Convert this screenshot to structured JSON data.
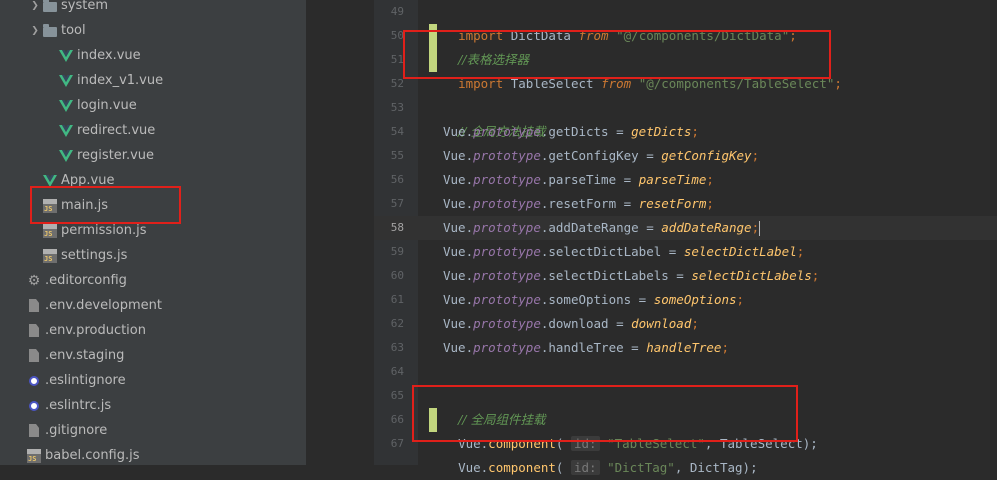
{
  "tree": [
    {
      "id": "system",
      "label": "system",
      "type": "folder",
      "expandable": true
    },
    {
      "id": "tool",
      "label": "tool",
      "type": "folder",
      "expandable": true
    },
    {
      "id": "index-vue",
      "label": "index.vue",
      "type": "vue"
    },
    {
      "id": "index-v1-vue",
      "label": "index_v1.vue",
      "type": "vue"
    },
    {
      "id": "login-vue",
      "label": "login.vue",
      "type": "vue"
    },
    {
      "id": "redirect-vue",
      "label": "redirect.vue",
      "type": "vue"
    },
    {
      "id": "register-vue",
      "label": "register.vue",
      "type": "vue"
    },
    {
      "id": "app-vue",
      "label": "App.vue",
      "type": "vue"
    },
    {
      "id": "main-js",
      "label": "main.js",
      "type": "js"
    },
    {
      "id": "permission-js",
      "label": "permission.js",
      "type": "js"
    },
    {
      "id": "settings-js",
      "label": "settings.js",
      "type": "js"
    },
    {
      "id": "editorconfig",
      "label": ".editorconfig",
      "type": "gear"
    },
    {
      "id": "env-development",
      "label": ".env.development",
      "type": "doc"
    },
    {
      "id": "env-production",
      "label": ".env.production",
      "type": "doc"
    },
    {
      "id": "env-staging",
      "label": ".env.staging",
      "type": "doc"
    },
    {
      "id": "eslintignore",
      "label": ".eslintignore",
      "type": "circle"
    },
    {
      "id": "eslintrc-js",
      "label": ".eslintrc.js",
      "type": "circle"
    },
    {
      "id": "gitignore",
      "label": ".gitignore",
      "type": "doc"
    },
    {
      "id": "babel-config-js",
      "label": "babel.config.js",
      "type": "js"
    }
  ],
  "editor": {
    "line_numbers": [
      "49",
      "50",
      "51",
      "52",
      "53",
      "54",
      "55",
      "56",
      "57",
      "58",
      "59",
      "60",
      "61",
      "62",
      "63",
      "64",
      "65",
      "66",
      "67"
    ],
    "current_line": "58",
    "l49": {
      "kw": "import",
      "name": " DictData ",
      "from": "from",
      "str": "\"@/components/DictData\"",
      "end": ";"
    },
    "l50": {
      "comment": "//表格选择器"
    },
    "l51": {
      "kw": "import",
      "name": " TableSelect ",
      "from": "from",
      "str": "\"@/components/TableSelect\"",
      "end": ";"
    },
    "l53": {
      "comment": "// 全局方法挂载"
    },
    "proto_lines": [
      {
        "obj": "Vue",
        "proto": "prototype",
        "prop": ".getDicts = ",
        "fn": "getDicts",
        "end": ";"
      },
      {
        "obj": "Vue",
        "proto": "prototype",
        "prop": ".getConfigKey = ",
        "fn": "getConfigKey",
        "end": ";"
      },
      {
        "obj": "Vue",
        "proto": "prototype",
        "prop": ".parseTime = ",
        "fn": "parseTime",
        "end": ";"
      },
      {
        "obj": "Vue",
        "proto": "prototype",
        "prop": ".resetForm = ",
        "fn": "resetForm",
        "end": ";"
      },
      {
        "obj": "Vue",
        "proto": "prototype",
        "prop": ".addDateRange = ",
        "fn": "addDateRange",
        "end": ";"
      },
      {
        "obj": "Vue",
        "proto": "prototype",
        "prop": ".selectDictLabel = ",
        "fn": "selectDictLabel",
        "end": ";"
      },
      {
        "obj": "Vue",
        "proto": "prototype",
        "prop": ".selectDictLabels = ",
        "fn": "selectDictLabels",
        "end": ";"
      },
      {
        "obj": "Vue",
        "proto": "prototype",
        "prop": ".someOptions = ",
        "fn": "someOptions",
        "end": ";"
      },
      {
        "obj": "Vue",
        "proto": "prototype",
        "prop": ".download = ",
        "fn": "download",
        "end": ";"
      },
      {
        "obj": "Vue",
        "proto": "prototype",
        "prop": ".handleTree = ",
        "fn": "handleTree",
        "end": ";"
      }
    ],
    "l65": {
      "comment": "// 全局组件挂载"
    },
    "l66": {
      "obj": "Vue.",
      "method": "component",
      "open": "( ",
      "hint": "id:",
      "str": " \"TableSelect\"",
      "rest": ", TableSelect);"
    },
    "l67": {
      "obj": "Vue.",
      "method": "component",
      "open": "( ",
      "hint": "id:",
      "str": " \"DictTag\"",
      "rest": ", DictTag);"
    }
  },
  "colors": {
    "highlight_box": "#e0201a",
    "change_marker": "#c2d67e",
    "vue_icon": "#41b883",
    "js_icon": "#e8c46a"
  }
}
